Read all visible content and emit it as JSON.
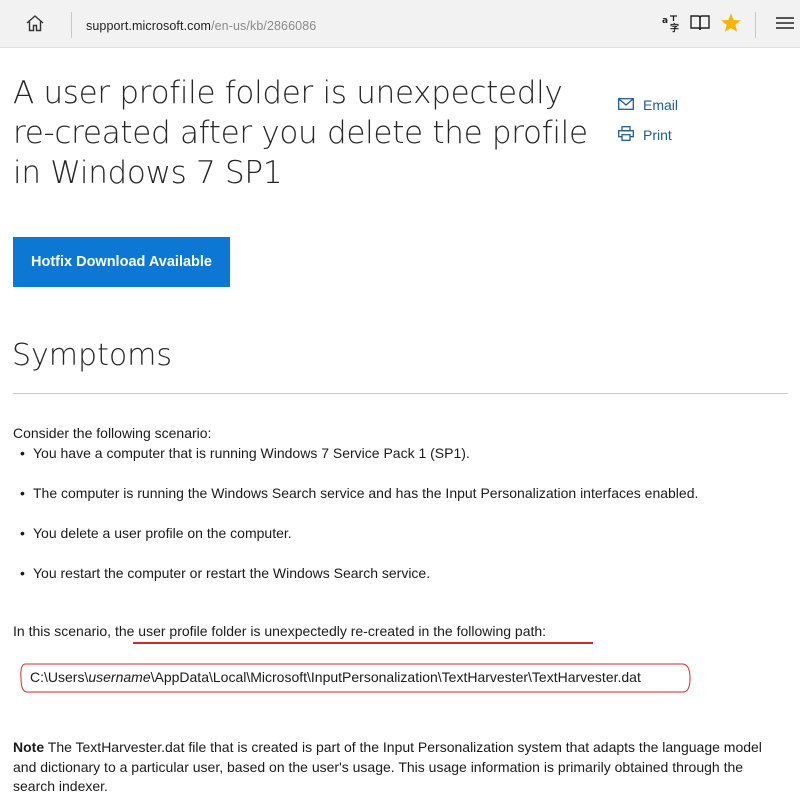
{
  "browser": {
    "url_host": "support.microsoft.com",
    "url_path": "/en-us/kb/2866086",
    "icons": [
      "home-icon",
      "translate-icon",
      "reading-view-icon",
      "favorite-star-icon",
      "hub-menu-icon"
    ],
    "star_color": "#f7b500"
  },
  "article": {
    "title": "A user profile folder is unexpectedly re-created after you delete the profile in Windows 7 SP1",
    "email_label": "Email",
    "print_label": "Print",
    "hotfix_button": "Hotfix Download Available",
    "accent_color": "#0d78d4"
  },
  "symptoms": {
    "heading": "Symptoms",
    "intro": "Consider the following scenario:",
    "bullets": [
      "You have a computer that is running Windows 7 Service Pack 1 (SP1).",
      "The computer is running the Windows Search service and has the Input Personalization interfaces enabled.",
      "You delete a user profile on the computer.",
      "You restart the computer or restart the Windows Search service."
    ],
    "scenario_prefix": "In this scenario, the user profile folder is unexpectedly re-created in the following path:",
    "path_before": "C:\\Users\\",
    "path_italic": "username",
    "path_after": "\\AppData\\Local\\Microsoft\\InputPersonalization\\TextHarvester\\TextHarvester.dat",
    "note_label": "Note",
    "note_text": " The TextHarvester.dat file that is created is part of the Input Personalization system that adapts the language model and dictionary to a particular user, based on the user's usage. This usage information is primarily obtained through the search indexer.",
    "annotation_color": "#d4262f"
  }
}
